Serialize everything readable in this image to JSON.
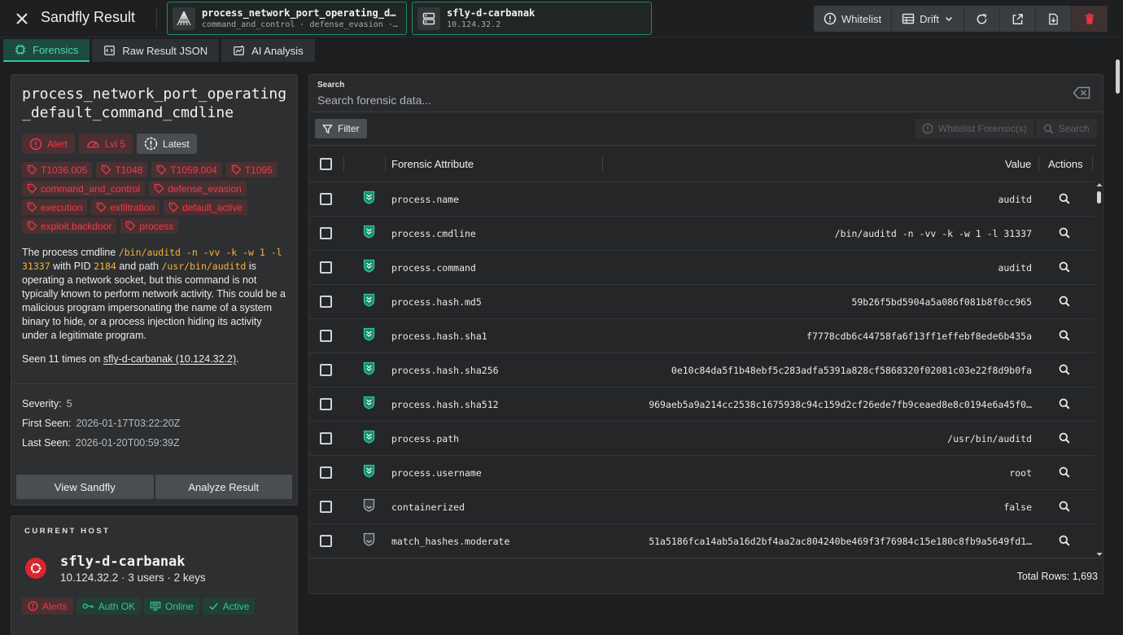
{
  "app": {
    "title": "Sandfly Result"
  },
  "context": {
    "result": {
      "title": "process_network_port_operating_de…",
      "subtitle": "command_and_control · defense_evasion ·…"
    },
    "host": {
      "title": "sfly-d-carbanak",
      "subtitle": "10.124.32.2"
    }
  },
  "toolbar": {
    "whitelist_label": "Whitelist",
    "drift_label": "Drift"
  },
  "tabs": [
    {
      "label": "Forensics",
      "active": true
    },
    {
      "label": "Raw Result JSON",
      "active": false
    },
    {
      "label": "AI Analysis",
      "active": false
    }
  ],
  "detail": {
    "title": "process_network_port_operating_default_command_cmdline",
    "badges": {
      "alert": "Alert",
      "level": "Lvl 5",
      "latest": "Latest"
    },
    "tags": [
      "T1036.005",
      "T1048",
      "T1059.004",
      "T1095",
      "command_and_control",
      "defense_evasion",
      "execution",
      "exfiltration",
      "default_active",
      "exploit.backdoor",
      "process"
    ],
    "description": {
      "p1": "The process cmdline",
      "cmd": "/bin/auditd -n -vv -k -w 1 -l 31337",
      "p2": "with PID",
      "pid": "2184",
      "p3": "and path",
      "path": "/usr/bin/auditd",
      "p4": "is operating a network socket, but this command is not typically known to perform network activity. This could be a malicious program impersonating the name of a system binary to hide, or a process injection hiding its activity under a legitimate program."
    },
    "seen": {
      "prefix": "Seen 11 times on",
      "host": "sfly-d-carbanak (10.124.32.2)",
      "suffix": "."
    },
    "severity": {
      "label": "Severity:",
      "value": "5"
    },
    "first_seen": {
      "label": "First Seen:",
      "value": "2026-01-17T03:22:20Z"
    },
    "last_seen": {
      "label": "Last Seen:",
      "value": "2026-01-20T00:59:39Z"
    },
    "buttons": {
      "view": "View Sandfly",
      "analyze": "Analyze Result"
    }
  },
  "host_card": {
    "label": "CURRENT HOST",
    "name": "sfly-d-carbanak",
    "meta": "10.124.32.2 · 3 users · 2 keys",
    "chips": {
      "alerts": "Alerts",
      "auth": "Auth OK",
      "online": "Online",
      "active": "Active"
    }
  },
  "forensics": {
    "search_label": "Search",
    "search_placeholder": "Search forensic data...",
    "filter_label": "Filter",
    "whitelist_label": "Whitelist Forensic(s)",
    "search_btn_label": "Search",
    "columns": {
      "attribute": "Forensic Attribute",
      "value": "Value",
      "actions": "Actions"
    },
    "rows": [
      {
        "attr": "process.name",
        "value": "auditd",
        "flagged": true
      },
      {
        "attr": "process.cmdline",
        "value": "/bin/auditd -n -vv -k -w 1 -l 31337",
        "flagged": true
      },
      {
        "attr": "process.command",
        "value": "auditd",
        "flagged": true
      },
      {
        "attr": "process.hash.md5",
        "value": "59b26f5bd5904a5a086f081b8f0cc965",
        "flagged": true
      },
      {
        "attr": "process.hash.sha1",
        "value": "f7778cdb6c44758fa6f13ff1effebf8ede6b435a",
        "flagged": true
      },
      {
        "attr": "process.hash.sha256",
        "value": "0e10c84da5f1b48ebf5c283adfa5391a828cf5868320f02081c03e22f8d9b0fa",
        "flagged": true
      },
      {
        "attr": "process.hash.sha512",
        "value": "969aeb5a9a214cc2538c1675938c94c159d2cf26ede7fb9ceaed8e8c0194e6a45f0…",
        "flagged": true
      },
      {
        "attr": "process.path",
        "value": "/usr/bin/auditd",
        "flagged": true
      },
      {
        "attr": "process.username",
        "value": "root",
        "flagged": true
      },
      {
        "attr": "containerized",
        "value": "false",
        "flagged": false
      },
      {
        "attr": "match_hashes.moderate",
        "value": "51a5186fca14ab5a16d2bf4aa2ac804240be469f3f76984c15e180c8fb9a5649fd1…",
        "flagged": false
      }
    ],
    "total_rows": "Total Rows: 1,693"
  },
  "colors": {
    "accent": "#2ec79d",
    "alert": "#f03a48",
    "code": "#f4b43b"
  }
}
